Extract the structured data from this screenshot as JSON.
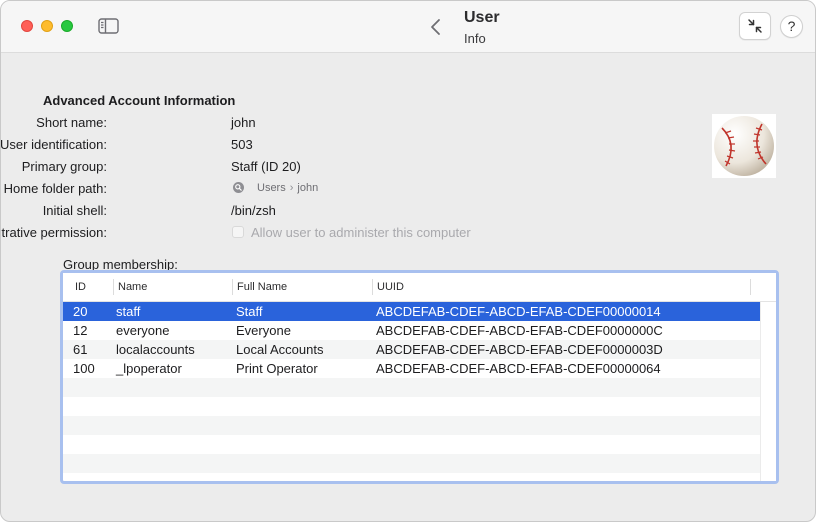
{
  "window": {
    "title": "User",
    "subtitle": "Info",
    "help_label": "?"
  },
  "icons": {
    "sidebar": "sidebar-toggle-icon",
    "back": "chevron-left-icon",
    "collapse": "arrows-inward-icon",
    "avatar": "baseball-avatar",
    "path": "magnifier-disk-icon"
  },
  "colors": {
    "selection": "#2a63db",
    "focus_ring": "#a8c0ef",
    "close": "#ff5f57",
    "minimize": "#febc2e",
    "maximize": "#28c840"
  },
  "section_title": "Advanced Account Information",
  "fields": {
    "short_name": {
      "label": "Short name:",
      "value": "john"
    },
    "uid": {
      "label": "User identification:",
      "value": "503"
    },
    "primary_group": {
      "label": "Primary group:",
      "value": "Staff (ID 20)"
    },
    "home_folder": {
      "label": "Home folder path:",
      "path": [
        "Users",
        "john"
      ],
      "separator": "›"
    },
    "shell": {
      "label": "Initial shell:",
      "value": "/bin/zsh"
    },
    "admin": {
      "label": "Administrative permission:",
      "checkbox_label": "Allow user to administer this computer",
      "checked": false
    }
  },
  "group_membership": {
    "label": "Group membership:",
    "columns": [
      "ID",
      "Name",
      "Full Name",
      "UUID"
    ],
    "rows": [
      {
        "id": "20",
        "name": "staff",
        "full_name": "Staff",
        "uuid": "ABCDEFAB-CDEF-ABCD-EFAB-CDEF00000014"
      },
      {
        "id": "12",
        "name": "everyone",
        "full_name": "Everyone",
        "uuid": "ABCDEFAB-CDEF-ABCD-EFAB-CDEF0000000C"
      },
      {
        "id": "61",
        "name": "localaccounts",
        "full_name": "Local Accounts",
        "uuid": "ABCDEFAB-CDEF-ABCD-EFAB-CDEF0000003D"
      },
      {
        "id": "100",
        "name": "_lpoperator",
        "full_name": "Print Operator",
        "uuid": "ABCDEFAB-CDEF-ABCD-EFAB-CDEF00000064"
      }
    ],
    "selected_row": 0
  }
}
